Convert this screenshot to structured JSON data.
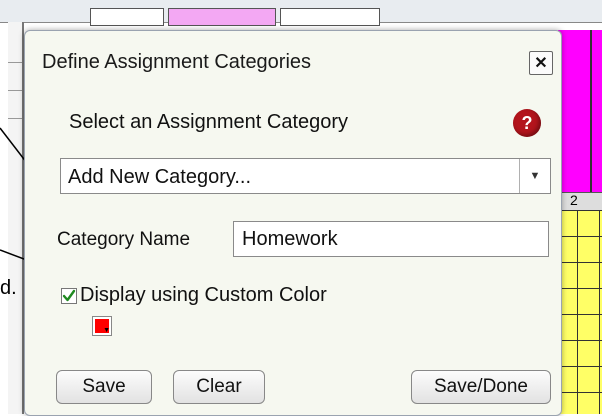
{
  "dialog": {
    "title": "Define Assignment Categories",
    "close_icon": "close-icon",
    "select_label": "Select an Assignment Category",
    "help_icon": "help-icon",
    "help_glyph": "?",
    "category_select": {
      "value": "Add New Category..."
    },
    "name_label": "Category Name",
    "name_value": "Homework",
    "custom_color_checked": true,
    "custom_color_label": "Display using Custom Color",
    "color_value": "#ff0000",
    "buttons": {
      "save": "Save",
      "clear": "Clear",
      "save_done": "Save/Done"
    }
  },
  "background": {
    "left_label_fragment": "d.",
    "column_number": "2"
  },
  "colors": {
    "accent_magenta": "#ff00ff",
    "grid_yellow": "#ffff66",
    "help_red": "#b3141c",
    "check_green": "#1f8a1f"
  }
}
